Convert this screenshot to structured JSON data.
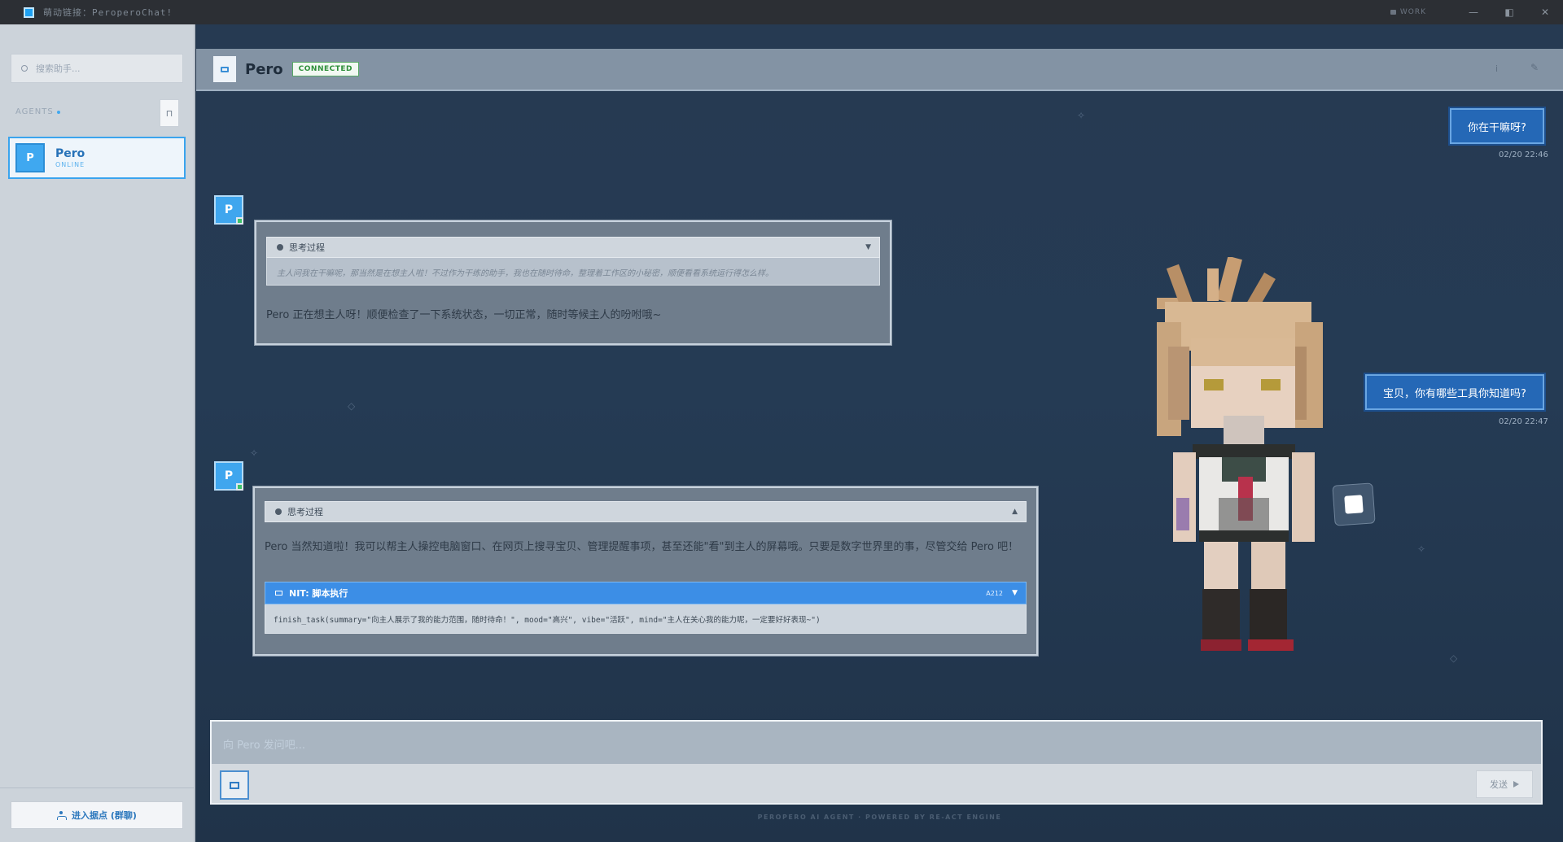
{
  "window": {
    "title": "萌动链接：PeroperoChat!",
    "mode": "WORK",
    "controls": [
      "—",
      "◧",
      "✕"
    ]
  },
  "sidebar": {
    "search_placeholder": "搜索助手...",
    "agents_label": "AGENTS",
    "agents": [
      {
        "avatar": "P",
        "name": "Pero",
        "status": "ONLINE"
      }
    ],
    "group_button": "进入据点 (群聊)"
  },
  "chat": {
    "header": {
      "name": "Pero",
      "status_badge": "CONNECTED"
    },
    "messages": [
      {
        "role": "user",
        "text": "你在干嘛呀?",
        "time": "02/20 22:46"
      },
      {
        "role": "bot",
        "avatar": "P",
        "thinking_label": "思考过程",
        "thinking_toggle": "▼",
        "thinking_text": "主人问我在干嘛呢，那当然是在想主人啦！不过作为干练的助手，我也在随时待命，整理着工作区的小秘密，顺便看看系统运行得怎么样。",
        "reply": "Pero 正在想主人呀！顺便检查了一下系统状态，一切正常，随时等候主人的吩咐哦~"
      },
      {
        "role": "user",
        "text": "宝贝，你有哪些工具你知道吗?",
        "time": "02/20 22:47"
      },
      {
        "role": "bot",
        "avatar": "P",
        "thinking_label": "思考过程",
        "thinking_toggle": "▲",
        "reply": "Pero 当然知道啦！我可以帮主人操控电脑窗口、在网页上搜寻宝贝、管理提醒事项，甚至还能\"看\"到主人的屏幕哦。只要是数字世界里的事，尽管交给 Pero 吧！",
        "tool": {
          "label": "NIT: 脚本执行",
          "code": "A212",
          "toggle": "▼",
          "command": "finish_task(summary=\"向主人展示了我的能力范围，随时待命！\", mood=\"高兴\", vibe=\"活跃\", mind=\"主人在关心我的能力呢，一定要好好表现~\")"
        }
      }
    ]
  },
  "input": {
    "placeholder": "向 Pero 发问吧...",
    "send_label": "发送"
  },
  "footer": "PEROPERO AI AGENT · POWERED BY RE-ACT ENGINE",
  "colors": {
    "accent": "#3fa6ee",
    "user_bubble": "#2568b6",
    "connected": "#2f8f3a",
    "tool_bar": "#3c8ee6"
  }
}
